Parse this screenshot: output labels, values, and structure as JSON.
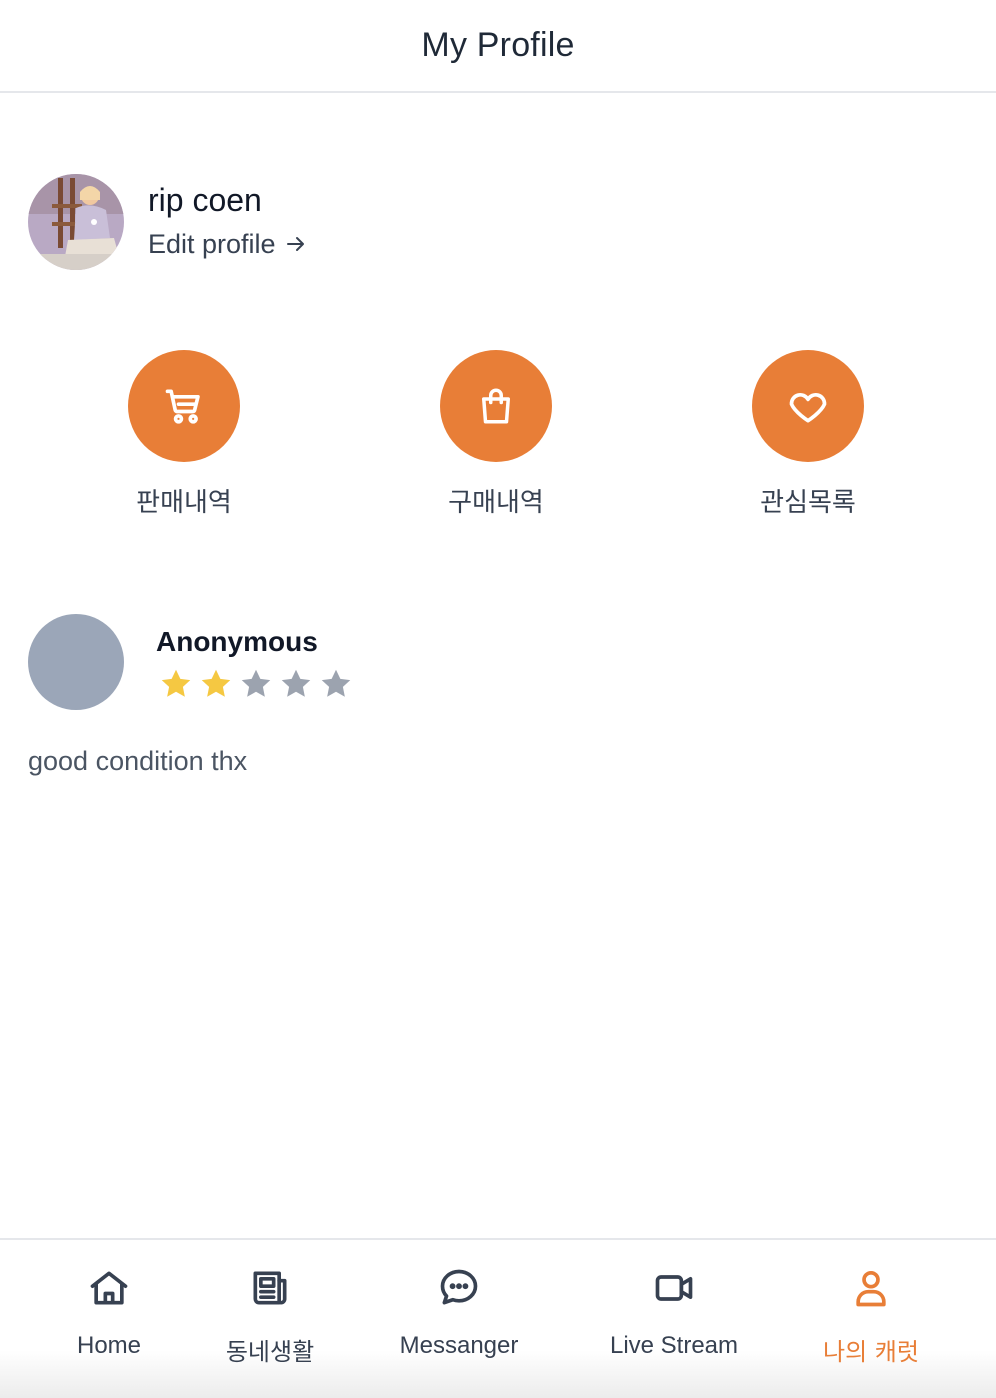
{
  "header": {
    "title": "My Profile"
  },
  "profile": {
    "username": "rip coen",
    "edit_label": "Edit profile"
  },
  "actions": [
    {
      "label": "판매내역",
      "icon": "cart-icon"
    },
    {
      "label": "구매내역",
      "icon": "shopping-bag-icon"
    },
    {
      "label": "관심목록",
      "icon": "heart-icon"
    }
  ],
  "review": {
    "reviewer": "Anonymous",
    "rating": 2,
    "max_rating": 5,
    "text": "good condition thx"
  },
  "nav": [
    {
      "label": "Home",
      "icon": "home-icon",
      "active": false
    },
    {
      "label": "동네생활",
      "icon": "newspaper-icon",
      "active": false
    },
    {
      "label": "Messanger",
      "icon": "chat-bubble-icon",
      "active": false
    },
    {
      "label": "Live Stream",
      "icon": "video-camera-icon",
      "active": false
    },
    {
      "label": "나의 캐럿",
      "icon": "user-icon",
      "active": true
    }
  ],
  "colors": {
    "accent": "#e87e37",
    "star_filled": "#f5c842",
    "star_empty": "#9ca3af",
    "avatar_placeholder": "#9ba6b8"
  }
}
